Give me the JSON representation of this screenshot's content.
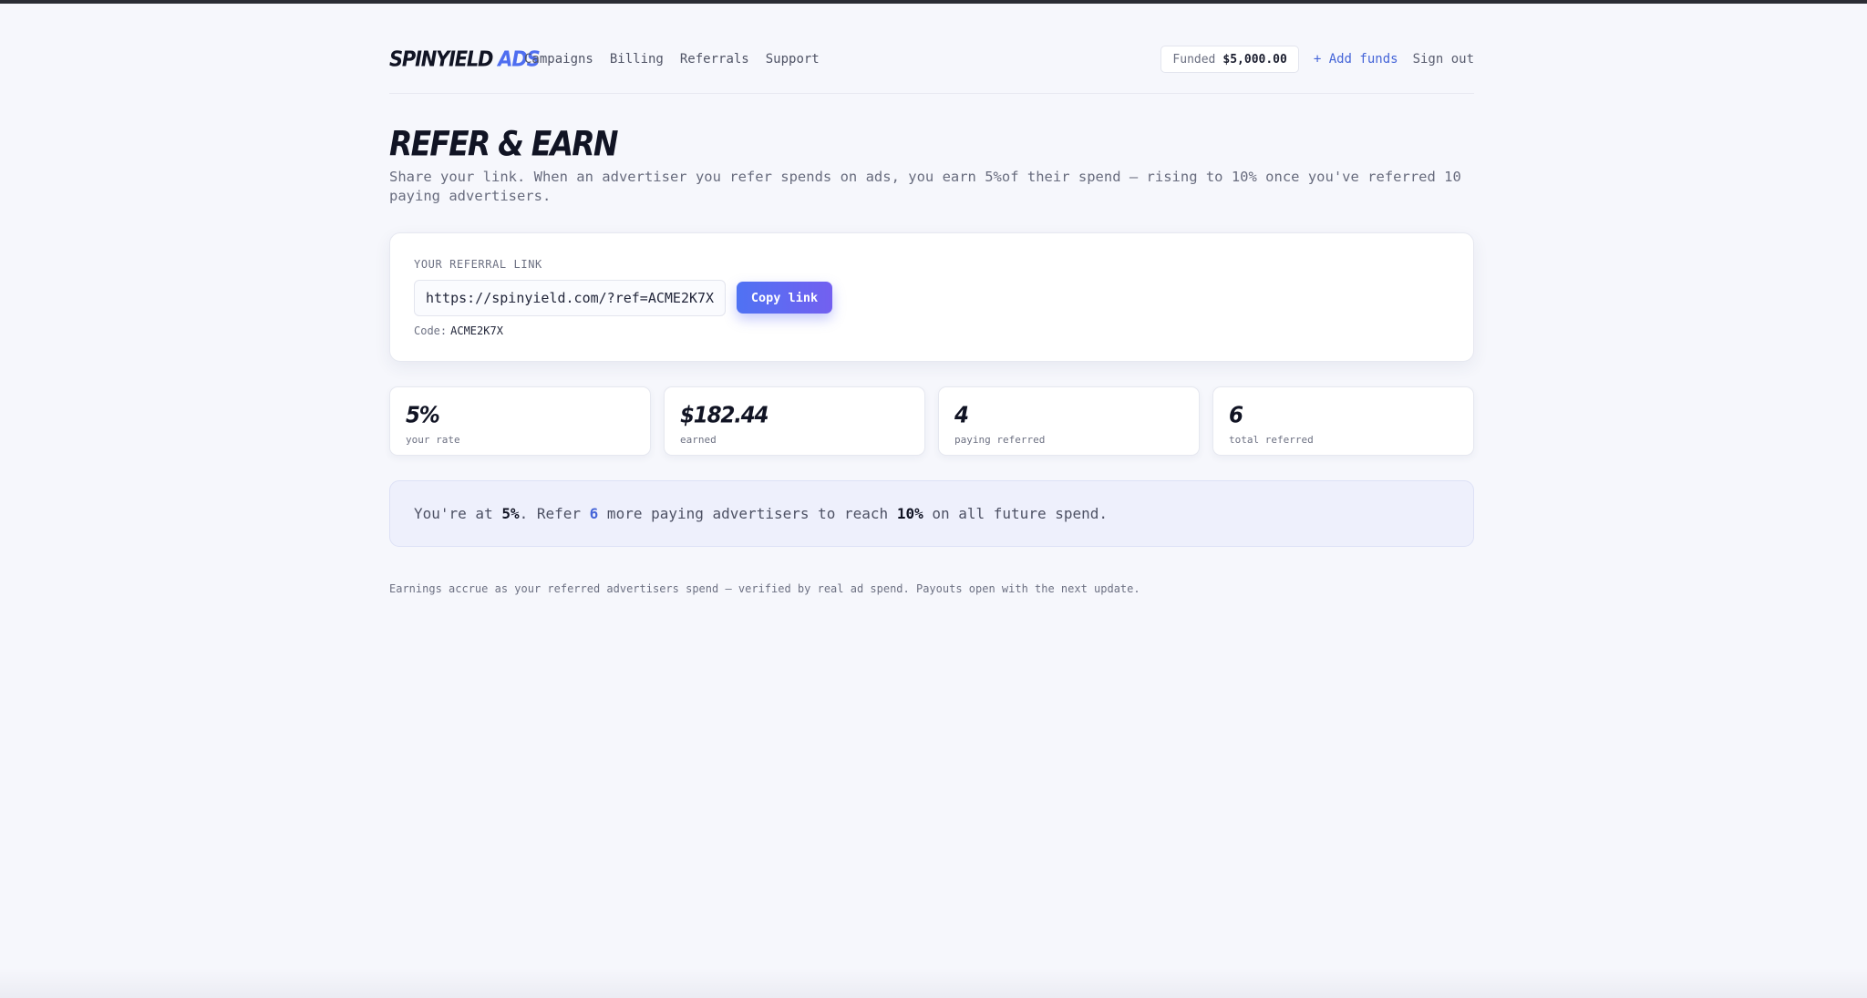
{
  "header": {
    "logo_main": "SPINYIELD",
    "logo_accent": "ADS",
    "nav": [
      {
        "label": "Campaigns"
      },
      {
        "label": "Billing"
      },
      {
        "label": "Referrals"
      },
      {
        "label": "Support"
      }
    ],
    "funded_label": "Funded",
    "funded_amount": "$5,000.00",
    "add_funds": "+ Add funds",
    "sign_out": "Sign out"
  },
  "page": {
    "title": "REFER & EARN",
    "subtitle": "Share your link. When an advertiser you refer spends on ads, you earn 5%of their spend — rising to 10% once you've referred 10 paying advertisers."
  },
  "referral": {
    "label": "YOUR REFERRAL LINK",
    "link": "https://spinyield.com/?ref=ACME2K7X",
    "copy_label": "Copy link",
    "code_label": "Code:",
    "code": "ACME2K7X"
  },
  "stats": [
    {
      "value": "5%",
      "label": "your rate"
    },
    {
      "value": "$182.44",
      "label": "earned"
    },
    {
      "value": "4",
      "label": "paying referred"
    },
    {
      "value": "6",
      "label": "total referred"
    }
  ],
  "progress": {
    "t1": "You're at ",
    "current_rate": "5%",
    "t2": ". Refer ",
    "remaining": "6",
    "t3": " more paying advertisers to reach ",
    "target_rate": "10%",
    "t4": " on all future spend."
  },
  "footnote": "Earnings accrue as your referred advertisers spend — verified by real ad spend. Payouts open with the next update.",
  "colors": {
    "accent": "#4f6ef0",
    "button_gradient_start": "#4f72f3",
    "button_gradient_end": "#7360f0",
    "background": "#f6f7fc"
  }
}
